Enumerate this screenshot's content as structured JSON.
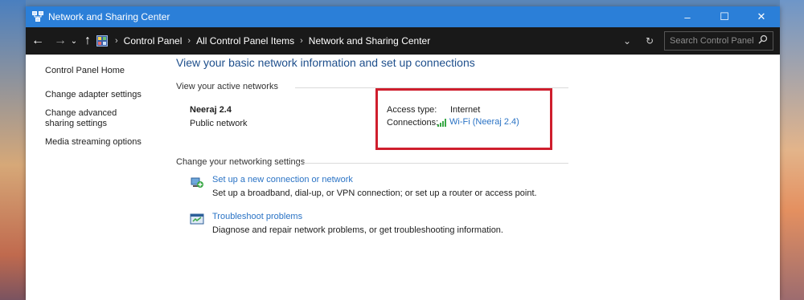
{
  "window": {
    "title": "Network and Sharing Center",
    "controls": {
      "minimize": "–",
      "maximize": "☐",
      "close": "✕"
    }
  },
  "addressbar": {
    "back": "←",
    "forward": "→",
    "recent": "⌄",
    "up": "↑",
    "crumbs": [
      "Control Panel",
      "All Control Panel Items",
      "Network and Sharing Center"
    ],
    "dropdown": "⌄",
    "refresh": "↻",
    "search_placeholder": "Search Control Panel"
  },
  "sidebar": {
    "items": [
      "Control Panel Home",
      "Change adapter settings",
      "Change advanced sharing settings",
      "Media streaming options"
    ]
  },
  "main": {
    "heading": "View your basic network information and set up connections",
    "active_networks_title": "View your active networks",
    "network": {
      "name": "Neeraj 2.4",
      "type": "Public network",
      "access_label": "Access type:",
      "access_value": "Internet",
      "connections_label": "Connections:",
      "connections_value": "Wi-Fi (Neeraj 2.4)"
    },
    "settings_title": "Change your networking settings",
    "tasks": [
      {
        "link": "Set up a new connection or network",
        "desc": "Set up a broadband, dial-up, or VPN connection; or set up a router or access point."
      },
      {
        "link": "Troubleshoot problems",
        "desc": "Diagnose and repair network problems, or get troubleshooting information."
      }
    ]
  },
  "colors": {
    "titlebar": "#2b7fd8",
    "link": "#2a73c5",
    "heading": "#1e4f8c",
    "highlight": "#cf1e2d"
  }
}
